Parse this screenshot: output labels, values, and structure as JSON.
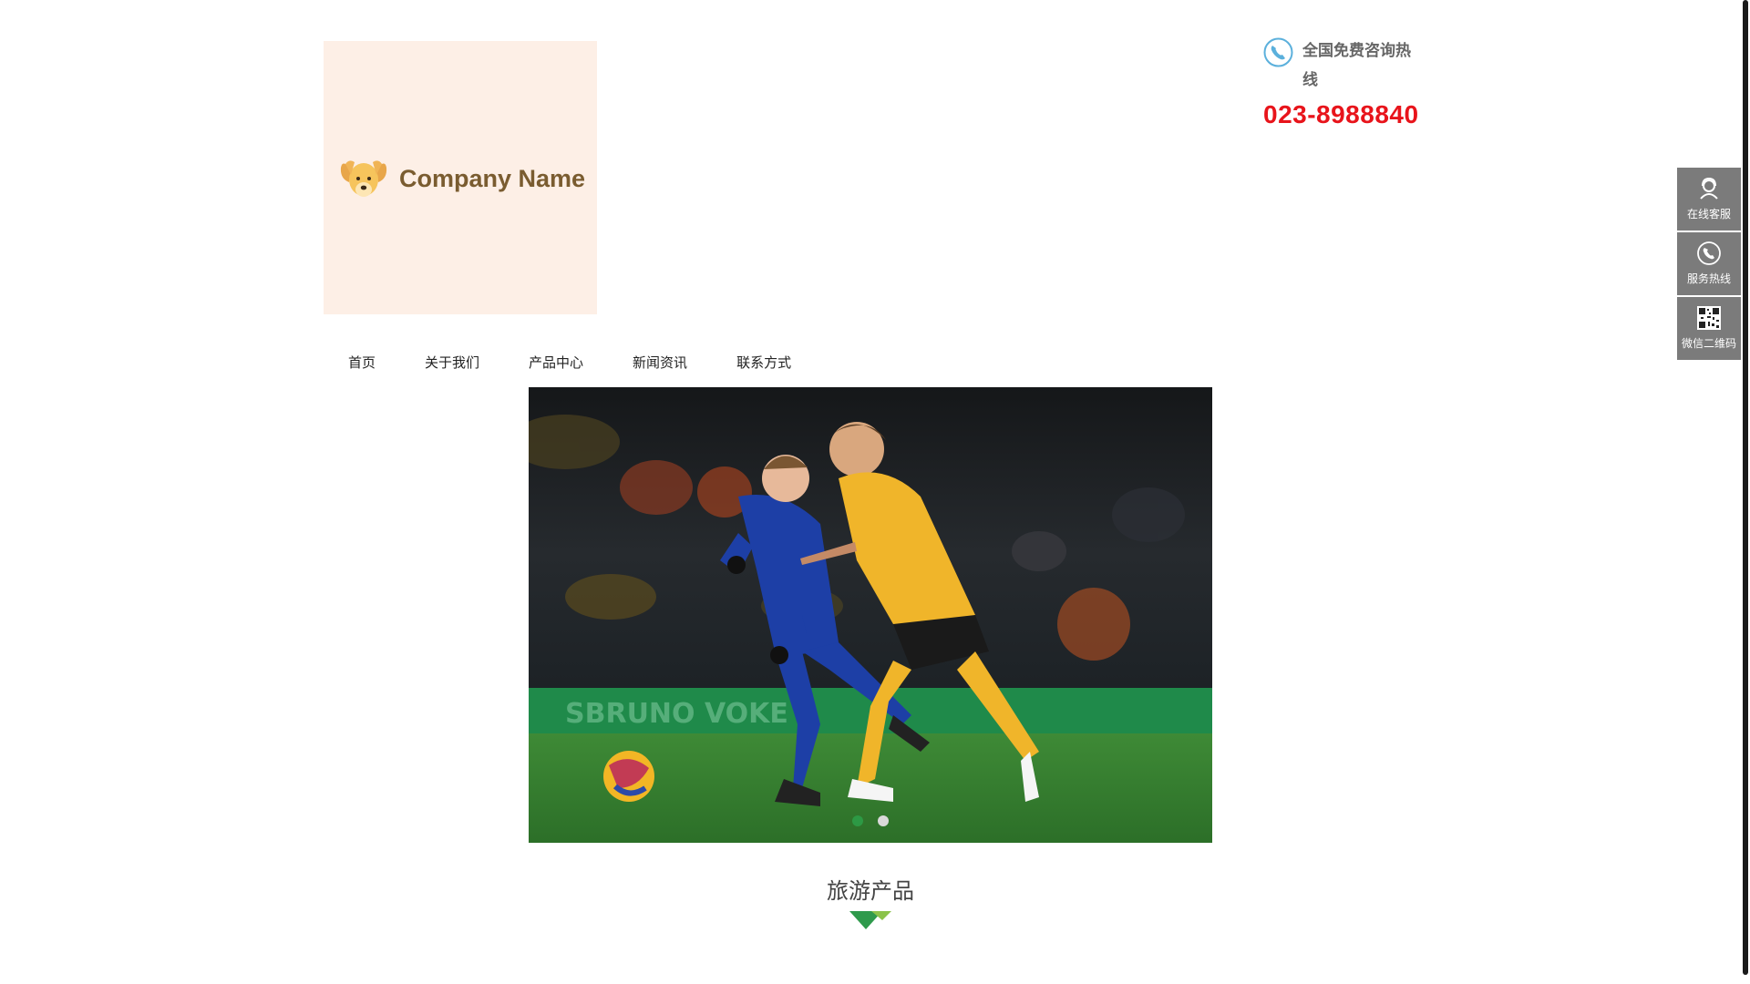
{
  "header": {
    "company_name": "Company Name",
    "hotline_label": "全国免费咨询热线",
    "hotline_number": "023-8988840"
  },
  "nav": {
    "items": [
      {
        "label": "首页"
      },
      {
        "label": "关于我们"
      },
      {
        "label": "产品中心"
      },
      {
        "label": "新闻资讯"
      },
      {
        "label": "联系方式"
      }
    ]
  },
  "banner": {
    "image_icon": "football-match-photo",
    "slide_count": 2,
    "active_slide": 1
  },
  "section": {
    "title": "旅游产品"
  },
  "float_bar": {
    "items": [
      {
        "label": "在线客服",
        "icon": "customer-service-icon"
      },
      {
        "label": "服务热线",
        "icon": "phone-icon"
      },
      {
        "label": "微信二维码",
        "icon": "qr-code-icon"
      }
    ]
  },
  "colors": {
    "logo_bg": "#fdefe6",
    "logo_text": "#7a5c30",
    "hotline_number": "#e8141b",
    "float_bg": "#7b7b7b",
    "accent_green": "#2e9d47"
  }
}
